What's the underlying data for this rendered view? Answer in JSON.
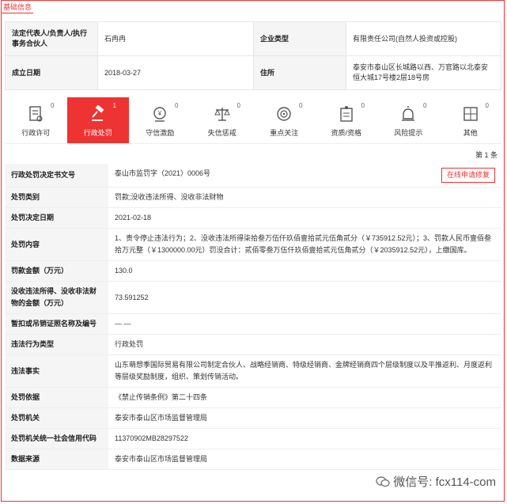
{
  "section_tag": "基础信息",
  "basic_info": {
    "legal_rep_label": "法定代表人/负责人/执行事务合伙人",
    "legal_rep_value": "石冉冉",
    "company_type_label": "企业类型",
    "company_type_value": "有限责任公司(自然人投资或控股)",
    "established_label": "成立日期",
    "established_value": "2018-03-27",
    "address_label": "住所",
    "address_value": "泰安市泰山区长城路以西、万官路以北泰安恒大城17号楼2层18号房"
  },
  "tabs": [
    {
      "label": "行政许可",
      "count": "0",
      "icon": "license-icon"
    },
    {
      "label": "行政处罚",
      "count": "1",
      "icon": "gavel-icon"
    },
    {
      "label": "守信激励",
      "count": "0",
      "icon": "incentive-icon"
    },
    {
      "label": "失信惩戒",
      "count": "0",
      "icon": "scale-icon"
    },
    {
      "label": "重点关注",
      "count": "0",
      "icon": "target-icon"
    },
    {
      "label": "资质/资格",
      "count": "0",
      "icon": "qualification-icon"
    },
    {
      "label": "风险提示",
      "count": "0",
      "icon": "alarm-icon"
    },
    {
      "label": "其他",
      "count": "0",
      "icon": "other-icon"
    }
  ],
  "pager": "第 1 条",
  "detail": {
    "repair_button": "在线申请修复",
    "rows": [
      {
        "label": "行政处罚决定书文号",
        "value": "泰山市监罚字（2021）0006号"
      },
      {
        "label": "处罚类别",
        "value": "罚款;没收违法所得、没收非法财物"
      },
      {
        "label": "处罚决定日期",
        "value": "2021-02-18"
      },
      {
        "label": "处罚内容",
        "value": "1、责令停止违法行为；2、没收违法所得柒拾叁万伍仟玖佰壹拾贰元伍角贰分（￥735912.52元）；3、罚款人民币壹佰叁拾万元整（￥1300000.00元）罚没合计：贰佰零叁万伍仟玖佰壹拾贰元伍角贰分（￥2035912.52元），上缴国库。"
      },
      {
        "label": "罚款金额（万元）",
        "value": "130.0"
      },
      {
        "label": "没收违法所得、没收非法财物的金额（万元）",
        "value": "73.591252"
      },
      {
        "label": "暂扣或吊销证照名称及编号",
        "value": "— —"
      },
      {
        "label": "违法行为类型",
        "value": "行政处罚"
      },
      {
        "label": "违法事实",
        "value": "山东萌想季国际贸易有限公司制定合伙人、战略经销商、特级经销商、金牌经销商四个层级制度以及平推返利、月度返利等层级奖励制度，组织、策划传销活动。"
      },
      {
        "label": "处罚依据",
        "value": "《禁止传销条例》第二十四条"
      },
      {
        "label": "处罚机关",
        "value": "泰安市泰山区市场监督管理局"
      },
      {
        "label": "处罚机关统一社会信用代码",
        "value": "11370902MB28297522"
      },
      {
        "label": "数据来源",
        "value": "泰安市泰山区市场监督管理局"
      }
    ]
  },
  "watermark": "微信号: fcx114-com"
}
